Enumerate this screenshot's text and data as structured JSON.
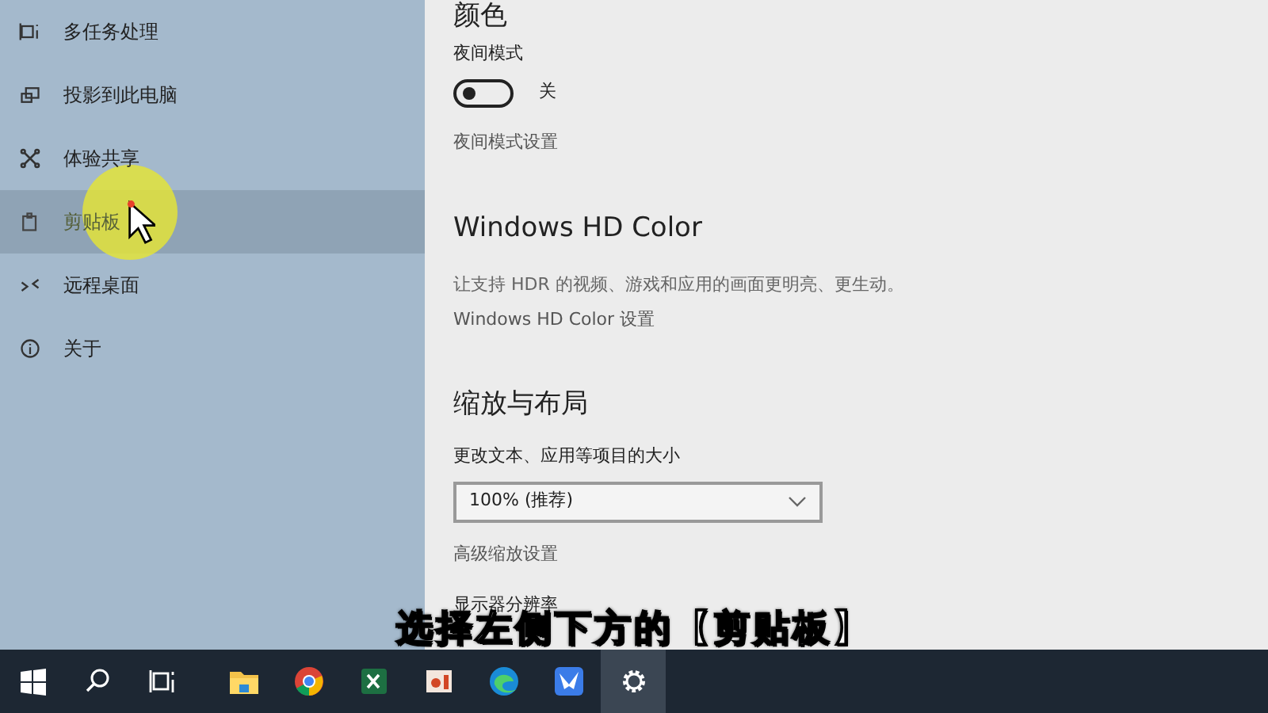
{
  "sidebar": {
    "items": [
      {
        "label": "多任务处理",
        "selected": false
      },
      {
        "label": "投影到此电脑",
        "selected": false
      },
      {
        "label": "体验共享",
        "selected": false
      },
      {
        "label": "剪贴板",
        "selected": true
      },
      {
        "label": "远程桌面",
        "selected": false
      },
      {
        "label": "关于",
        "selected": false
      }
    ]
  },
  "content": {
    "color_heading": "颜色",
    "night_mode_label": "夜间模式",
    "night_mode": {
      "on": false,
      "state_text": "关"
    },
    "night_mode_link": "夜间模式设置",
    "hd_heading": "Windows HD Color",
    "hd_description": "让支持 HDR 的视频、游戏和应用的画面更明亮、更生动。",
    "hd_link": "Windows HD Color 设置",
    "scale_heading": "缩放与布局",
    "scale_label": "更改文本、应用等项目的大小",
    "scale_value": "100% (推荐)",
    "scale_link": "高级缩放设置",
    "resolution_label": "显示器分辨率"
  },
  "caption": "选择左侧下方的【剪贴板】",
  "taskbar": {
    "apps": [
      {
        "active": false
      },
      {
        "active": false
      },
      {
        "active": false
      },
      {
        "active": false
      },
      {
        "active": false
      },
      {
        "active": false
      },
      {
        "active": false
      },
      {
        "active": false
      },
      {
        "active": false
      },
      {
        "active": true
      }
    ]
  }
}
